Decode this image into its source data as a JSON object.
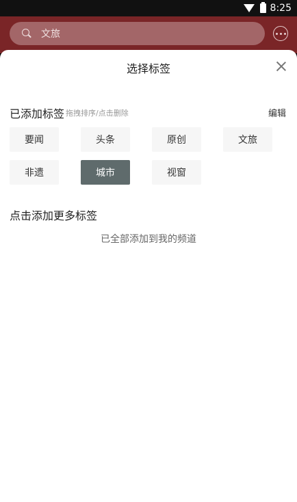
{
  "status": {
    "time": "8:25"
  },
  "header": {
    "search_placeholder": "文旅",
    "colors": {
      "bar": "#7a2527",
      "search_bg": "#a36668"
    }
  },
  "sheet": {
    "title": "选择标签",
    "added_section": {
      "label": "已添加标签",
      "hint": "拖拽排序/点击删除",
      "edit_label": "编辑",
      "tags": [
        {
          "label": "要闻",
          "selected": false
        },
        {
          "label": "头条",
          "selected": false
        },
        {
          "label": "原创",
          "selected": false
        },
        {
          "label": "文旅",
          "selected": false
        },
        {
          "label": "非遗",
          "selected": false
        },
        {
          "label": "城市",
          "selected": true
        },
        {
          "label": "视窗",
          "selected": false
        }
      ]
    },
    "more_section": {
      "label": "点击添加更多标签",
      "empty_text": "已全部添加到我的频道"
    }
  }
}
